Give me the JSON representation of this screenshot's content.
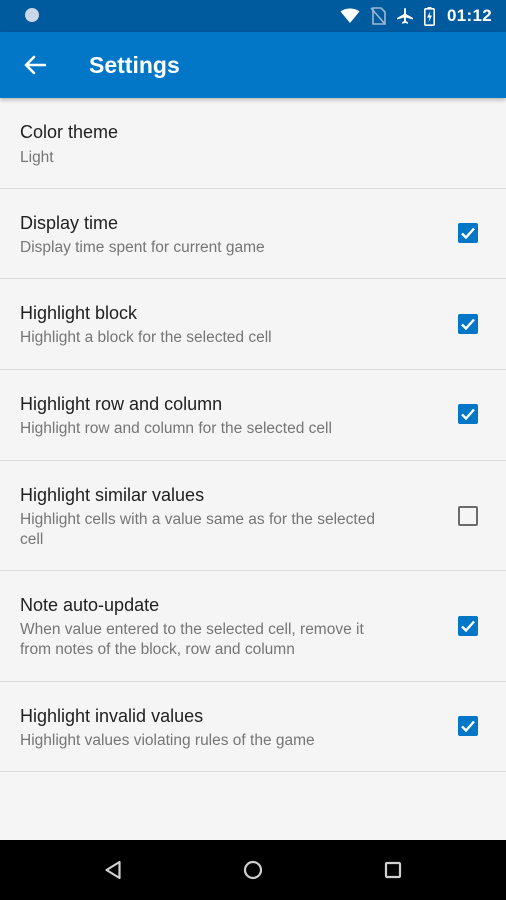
{
  "status_bar": {
    "time": "01:12",
    "icons": [
      "notification-dot-icon",
      "wifi-icon",
      "no-sim-icon",
      "airplane-icon",
      "battery-icon"
    ]
  },
  "app_bar": {
    "title": "Settings",
    "back_icon": "arrow-left-icon"
  },
  "colors": {
    "status_bar": "#005a9e",
    "app_bar": "#0277c8",
    "accent": "#0277c8",
    "background": "#f5f5f5"
  },
  "settings": {
    "items": [
      {
        "title": "Color theme",
        "subtitle": "Light"
      },
      {
        "title": "Display time",
        "subtitle": "Display time spent for current game",
        "checked": true
      },
      {
        "title": "Highlight block",
        "subtitle": "Highlight a block for the selected cell",
        "checked": true
      },
      {
        "title": "Highlight row and column",
        "subtitle": "Highlight row and column for the selected cell",
        "checked": true
      },
      {
        "title": "Highlight similar values",
        "subtitle_line1": "Highlight cells with a value same as for the selected",
        "subtitle_line2": "cell",
        "checked": false
      },
      {
        "title": "Note auto-update",
        "subtitle_line1": "When value entered to the selected cell, remove it",
        "subtitle_line2": "from notes of the block, row and column",
        "checked": true
      },
      {
        "title": "Highlight invalid values",
        "subtitle": "Highlight values violating rules of the game",
        "checked": true
      }
    ]
  },
  "nav_bar": {
    "icons": [
      "back-triangle-icon",
      "home-circle-icon",
      "recents-square-icon"
    ]
  }
}
